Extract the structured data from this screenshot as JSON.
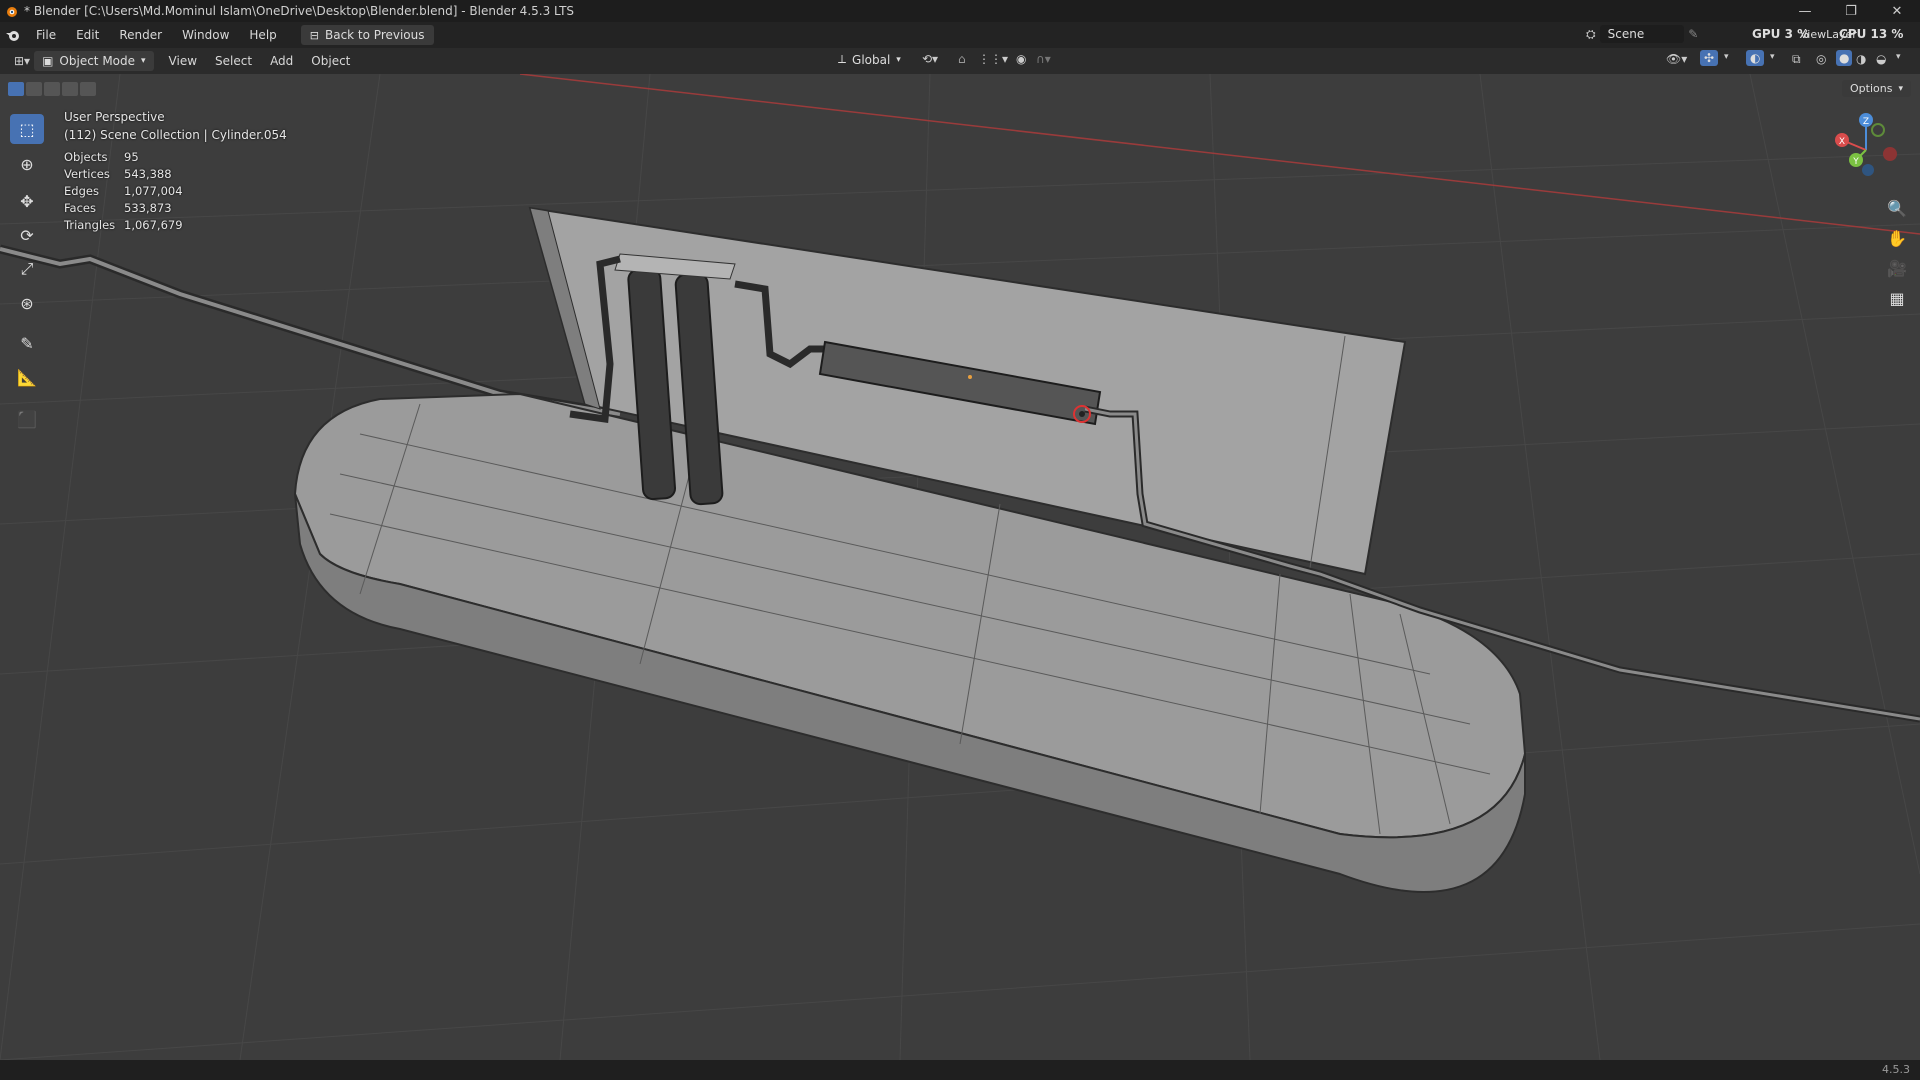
{
  "window": {
    "title": "* Blender [C:\\Users\\Md.Mominul Islam\\OneDrive\\Desktop\\Blender.blend] - Blender 4.5.3 LTS",
    "controls": [
      "—",
      "❐",
      "✕"
    ]
  },
  "menubar": {
    "items": [
      "File",
      "Edit",
      "Render",
      "Window",
      "Help"
    ],
    "back_button": "Back to Previous",
    "scene": "Scene",
    "gpu_label": "GPU",
    "gpu_value": "3 %",
    "cpu_label": "CPU",
    "cpu_value": "13 %",
    "view_layer": "ViewLayer"
  },
  "header": {
    "mode": "Object Mode",
    "menus": [
      "View",
      "Select",
      "Add",
      "Object"
    ],
    "orientation": "Global",
    "options": "Options"
  },
  "viewport": {
    "perspective": "User Perspective",
    "collection": "(112) Scene Collection | Cylinder.054",
    "stats": [
      {
        "label": "Objects",
        "value": "95"
      },
      {
        "label": "Vertices",
        "value": "543,388"
      },
      {
        "label": "Edges",
        "value": "1,077,004"
      },
      {
        "label": "Faces",
        "value": "533,873"
      },
      {
        "label": "Triangles",
        "value": "1,067,679"
      }
    ],
    "gizmo": {
      "x": "X",
      "y": "Y",
      "z": "Z"
    }
  },
  "toolbar": {
    "tools": [
      "select-box-icon",
      "cursor-icon",
      "move-icon",
      "rotate-icon",
      "scale-icon",
      "transform-icon",
      "annotate-icon",
      "measure-icon",
      "add-cube-icon"
    ]
  },
  "statusbar": {
    "version": "4.5.3"
  },
  "colors": {
    "background": "#3d3d3d",
    "header": "#2b2b2b",
    "titlebar": "#1d1d1d",
    "accent": "#4772b3",
    "x_axis": "#d94c4c",
    "y_axis": "#7bc142",
    "z_axis": "#4c8dd9"
  }
}
